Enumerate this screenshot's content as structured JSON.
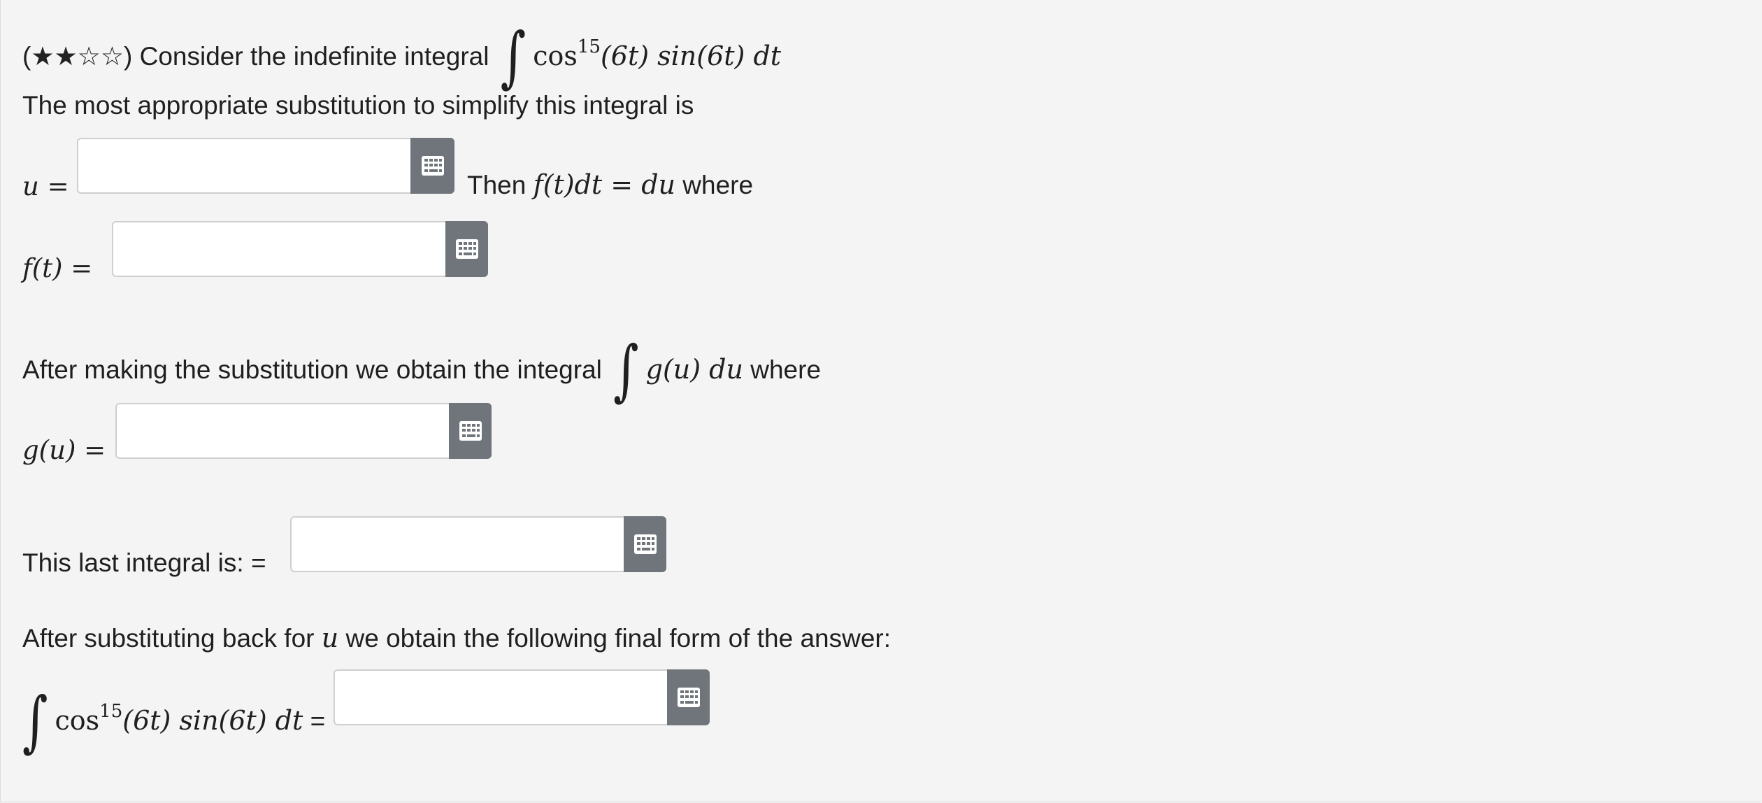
{
  "question": {
    "difficulty_prefix": "(",
    "stars_filled": "★★",
    "stars_empty": "☆☆",
    "difficulty_suffix": ")",
    "intro": "Consider the indefinite integral",
    "integrand_cos": "cos",
    "integrand_power": "15",
    "integrand_rest": "(6t) sin(6t) dt",
    "substitution_prompt": "The most appropriate substitution to simplify this integral is"
  },
  "u_field": {
    "label": "u =",
    "then_prefix": "Then",
    "then_math": "f(t)dt = du",
    "then_suffix": "where"
  },
  "f_field": {
    "label": "f(t) ="
  },
  "after_sub": {
    "text": "After making the substitution we obtain the integral",
    "math": "g(u) du",
    "suffix": "where"
  },
  "g_field": {
    "label": "g(u) ="
  },
  "last_integral": {
    "label": "This last integral is: ="
  },
  "back_sub": {
    "prefix": "After substituting back for",
    "var": "u",
    "suffix": "we obtain the following final form of the answer:"
  },
  "final_field": {
    "cos": "cos",
    "power": "15",
    "rest": "(6t) sin(6t) dt",
    "equals": "="
  },
  "inputs": {
    "u_value": "",
    "f_value": "",
    "g_value": "",
    "last_value": "",
    "final_value": ""
  },
  "icons": {
    "keyboard": "keyboard-grid-icon"
  },
  "colors": {
    "background": "#f4f4f4",
    "button": "#6f757b"
  }
}
